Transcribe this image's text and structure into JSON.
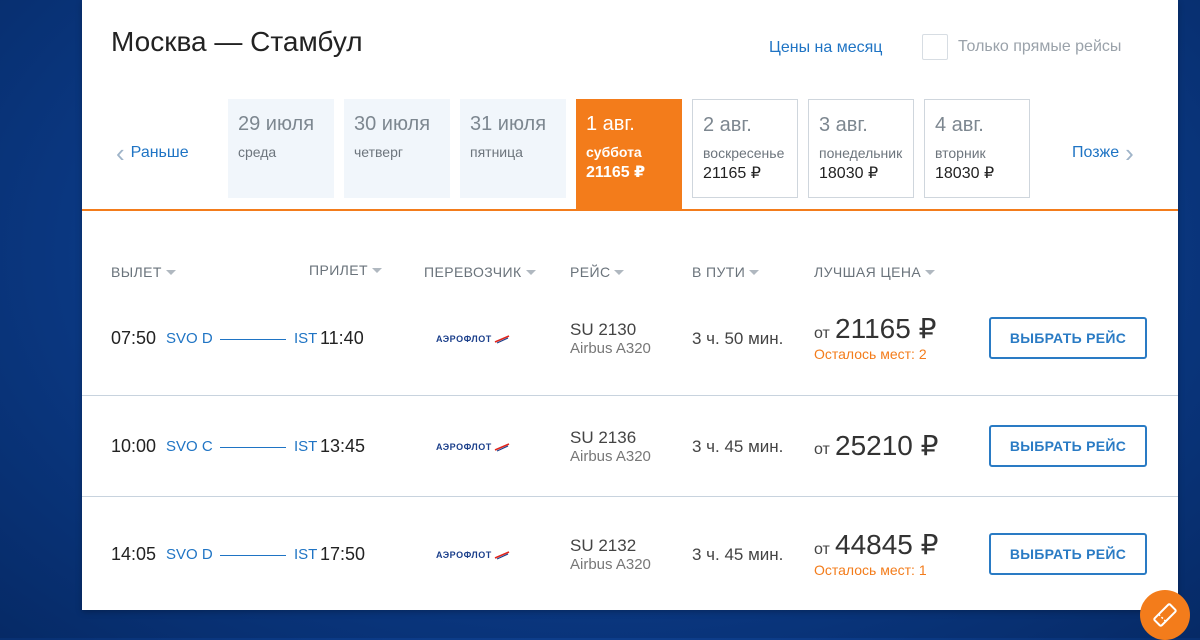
{
  "header": {
    "title": "Москва — Стамбул",
    "month_prices_link": "Цены на месяц",
    "direct_only_label": "Только прямые рейсы"
  },
  "date_nav": {
    "prev_label": "Раньше",
    "next_label": "Позже",
    "dates": [
      {
        "date": "29 июля",
        "weekday": "среда",
        "price": ""
      },
      {
        "date": "30 июля",
        "weekday": "четверг",
        "price": ""
      },
      {
        "date": "31 июля",
        "weekday": "пятница",
        "price": ""
      },
      {
        "date": "1 авг.",
        "weekday": "суббота",
        "price": "21165 ₽",
        "selected": true
      },
      {
        "date": "2 авг.",
        "weekday": "воскресенье",
        "price": "21165 ₽"
      },
      {
        "date": "3 авг.",
        "weekday": "понедельник",
        "price": "18030 ₽"
      },
      {
        "date": "4 авг.",
        "weekday": "вторник",
        "price": "18030 ₽"
      }
    ]
  },
  "columns": {
    "departure": "ВЫЛЕТ",
    "arrival": "ПРИЛЕТ",
    "carrier": "ПЕРЕВОЗЧИК",
    "flight": "РЕЙС",
    "duration": "В ПУТИ",
    "best_price": "ЛУЧШАЯ ЦЕНА"
  },
  "flights": [
    {
      "dep_time": "07:50",
      "dep_airport": "SVO D",
      "arr_airport": "IST",
      "arr_time": "11:40",
      "carrier": "АЭРОФЛОТ",
      "flight_no": "SU 2130",
      "aircraft": "Airbus A320",
      "duration": "3 ч. 50 мин.",
      "from_label": "от",
      "price": "21165 ₽",
      "seats_left": "Осталось мест: 2",
      "button": "ВЫБРАТЬ РЕЙС"
    },
    {
      "dep_time": "10:00",
      "dep_airport": "SVO C",
      "arr_airport": "IST",
      "arr_time": "13:45",
      "carrier": "АЭРОФЛОТ",
      "flight_no": "SU 2136",
      "aircraft": "Airbus A320",
      "duration": "3 ч. 45 мин.",
      "from_label": "от",
      "price": "25210 ₽",
      "seats_left": "",
      "button": "ВЫБРАТЬ РЕЙС"
    },
    {
      "dep_time": "14:05",
      "dep_airport": "SVO D",
      "arr_airport": "IST",
      "arr_time": "17:50",
      "carrier": "АЭРОФЛОТ",
      "flight_no": "SU 2132",
      "aircraft": "Airbus A320",
      "duration": "3 ч. 45 мин.",
      "from_label": "от",
      "price": "44845 ₽",
      "seats_left": "Осталось мест: 1",
      "button": "ВЫБРАТЬ РЕЙС"
    }
  ],
  "colors": {
    "accent": "#f37c1b",
    "link": "#1f74c4"
  }
}
